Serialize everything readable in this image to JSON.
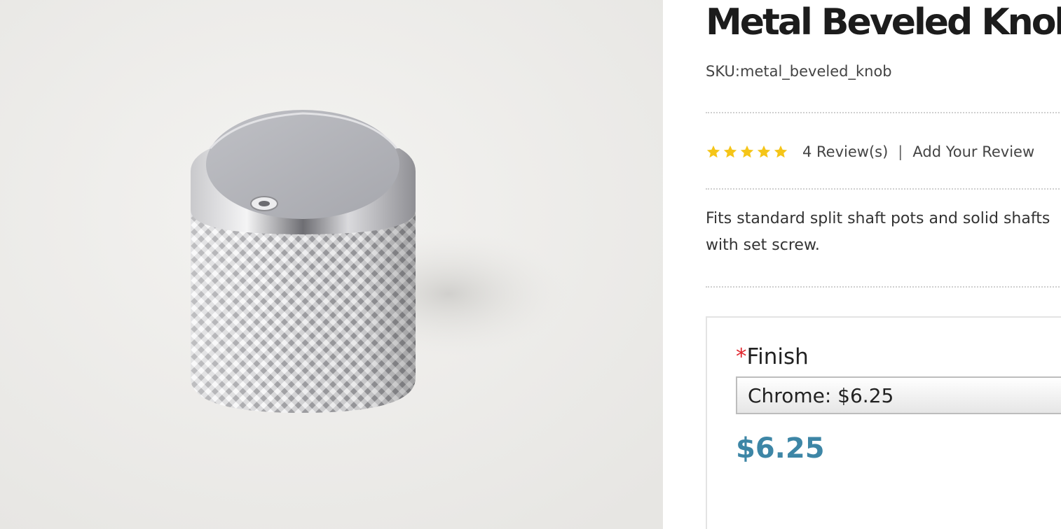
{
  "product": {
    "title": "Metal Beveled Knob",
    "sku": "SKU:metal_beveled_knob",
    "rating": {
      "stars": 5,
      "max": 5,
      "color": "#f5c518"
    },
    "reviews_count": "4 Review(s)",
    "separator": "|",
    "add_review": "Add Your Review",
    "description": "Fits standard split shaft pots and solid shafts with set screw.",
    "image_icon": "chrome-knob-photo"
  },
  "options": {
    "required_mark": "*",
    "finish_label": "Finish",
    "finish_selected": "Chrome: $6.25",
    "price": "$6.25",
    "price_color": "#3d86a6"
  }
}
